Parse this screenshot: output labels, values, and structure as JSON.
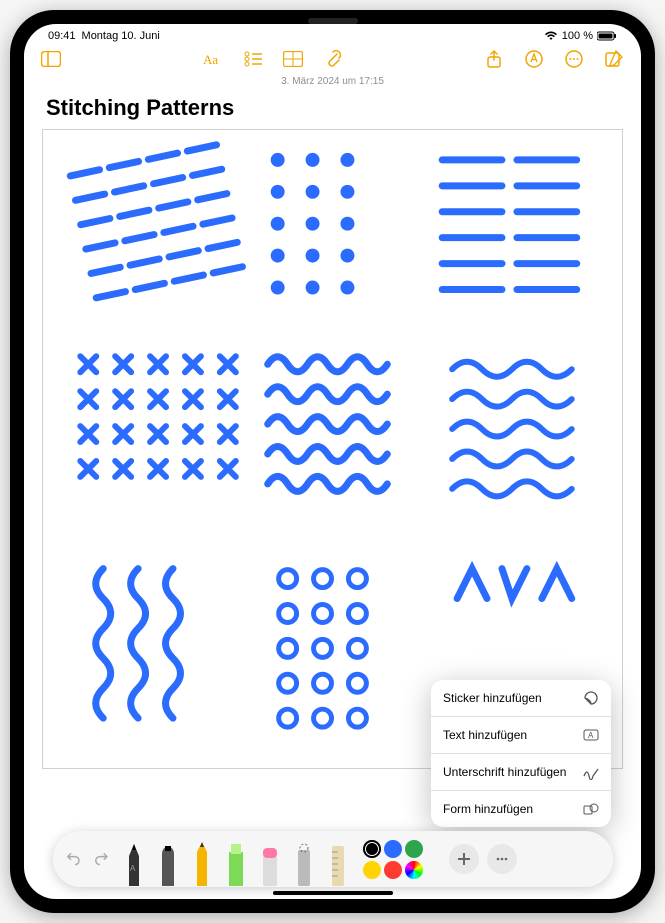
{
  "status": {
    "time": "09:41",
    "date": "Montag 10. Juni",
    "battery": "100 %"
  },
  "note": {
    "timestamp": "3. März 2024 um 17:15",
    "title": "Stitching Patterns"
  },
  "popup": {
    "items": [
      {
        "label": "Sticker hinzufügen",
        "icon": "sticker"
      },
      {
        "label": "Text hinzufügen",
        "icon": "text"
      },
      {
        "label": "Unterschrift hinzufügen",
        "icon": "signature"
      },
      {
        "label": "Form hinzufügen",
        "icon": "shape"
      }
    ]
  },
  "colors": {
    "swatches": [
      "#000000",
      "#2b6cff",
      "#2ea44f",
      "#ffd400",
      "#ff3b30"
    ],
    "selected": 0
  },
  "accent": "#f0a500",
  "stroke": "#2b6cff"
}
